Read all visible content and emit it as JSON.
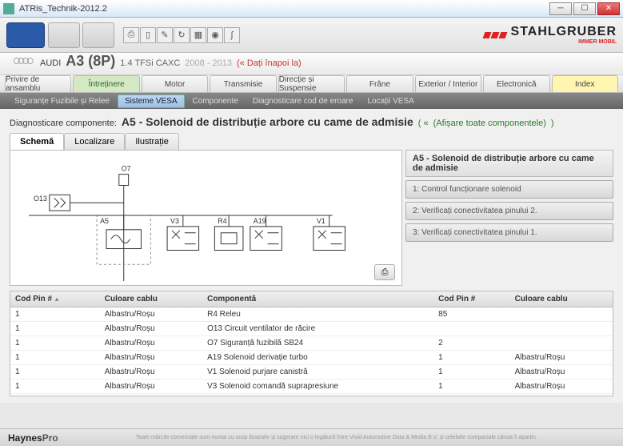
{
  "window": {
    "title": "ATRis_Technik-2012.2"
  },
  "brand": {
    "name": "STAHLGRUBER",
    "tagline": "IMMER MOBIL"
  },
  "vehicle": {
    "make": "AUDI",
    "model": "A3 (8P)",
    "engine": "1.4 TFSi CAXC",
    "years": "2008 - 2013",
    "back": "(« Dați înapoi la)"
  },
  "maintabs": [
    "Privire de ansamblu",
    "Întreținere",
    "Motor",
    "Transmisie",
    "Direcție și Suspensie",
    "Frâne",
    "Exterior / Interior",
    "Electronică",
    "Index"
  ],
  "maintab_active": 1,
  "subtabs": [
    "Siguranțe Fuzibile și Relee",
    "Sisteme VESA",
    "Componente",
    "Diagnosticare cod de eroare",
    "Locații VESA"
  ],
  "subtab_active": 1,
  "heading": {
    "prefix": "Diagnosticare componente:",
    "title": "A5 - Solenoid de distribuție arbore cu came de admisie",
    "link_prefix": "( «",
    "link": "(Afișare toate componentele)",
    "link_suffix": ")"
  },
  "viewtabs": [
    "Schemă",
    "Localizare",
    "Ilustrație"
  ],
  "viewtab_active": 0,
  "side": {
    "title": "A5 - Solenoid de distribuție arbore cu came de admisie",
    "steps": [
      "1: Control funcționare solenoid",
      "2: Verificați conectivitatea pinului 2.",
      "3: Verificați conectivitatea pinului 1."
    ]
  },
  "diagram_labels": {
    "o7": "O7",
    "o13": "O13",
    "a5": "A5",
    "v3": "V3",
    "r4": "R4",
    "a19": "A19",
    "v1": "V1"
  },
  "table": {
    "headers": [
      "Cod Pin #",
      "Culoare cablu",
      "Componentă",
      "Cod Pin #",
      "Culoare cablu"
    ],
    "rows": [
      [
        "1",
        "Albastru/Roșu",
        "R4 Releu",
        "85",
        ""
      ],
      [
        "1",
        "Albastru/Roșu",
        "O13 Circuit ventilator de răcire",
        "",
        ""
      ],
      [
        "1",
        "Albastru/Roșu",
        "O7 Siguranță fuzibilă SB24",
        "2",
        ""
      ],
      [
        "1",
        "Albastru/Roșu",
        "A19 Solenoid derivație turbo",
        "1",
        "Albastru/Roșu"
      ],
      [
        "1",
        "Albastru/Roșu",
        "V1 Solenoid purjare canistră",
        "1",
        "Albastru/Roșu"
      ],
      [
        "1",
        "Albastru/Roșu",
        "V3 Solenoid comandă suprapresiune",
        "1",
        "Albastru/Roșu"
      ]
    ]
  },
  "footer": {
    "logo1": "Haynes",
    "logo2": "Pro"
  }
}
